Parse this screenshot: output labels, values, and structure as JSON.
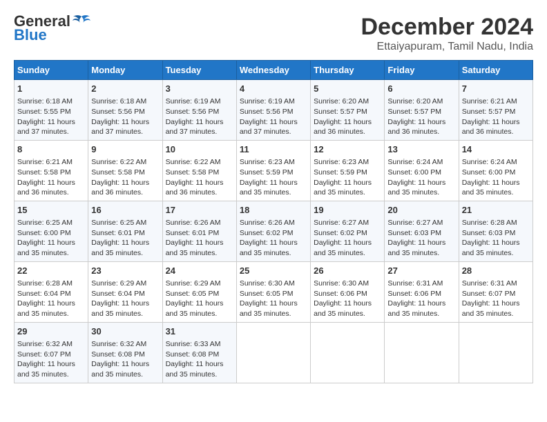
{
  "header": {
    "logo_line1": "General",
    "logo_line2": "Blue",
    "title": "December 2024",
    "subtitle": "Ettaiyapuram, Tamil Nadu, India"
  },
  "columns": [
    "Sunday",
    "Monday",
    "Tuesday",
    "Wednesday",
    "Thursday",
    "Friday",
    "Saturday"
  ],
  "weeks": [
    [
      {
        "day": "1",
        "lines": [
          "Sunrise: 6:18 AM",
          "Sunset: 5:55 PM",
          "Daylight: 11 hours",
          "and 37 minutes."
        ]
      },
      {
        "day": "2",
        "lines": [
          "Sunrise: 6:18 AM",
          "Sunset: 5:56 PM",
          "Daylight: 11 hours",
          "and 37 minutes."
        ]
      },
      {
        "day": "3",
        "lines": [
          "Sunrise: 6:19 AM",
          "Sunset: 5:56 PM",
          "Daylight: 11 hours",
          "and 37 minutes."
        ]
      },
      {
        "day": "4",
        "lines": [
          "Sunrise: 6:19 AM",
          "Sunset: 5:56 PM",
          "Daylight: 11 hours",
          "and 37 minutes."
        ]
      },
      {
        "day": "5",
        "lines": [
          "Sunrise: 6:20 AM",
          "Sunset: 5:57 PM",
          "Daylight: 11 hours",
          "and 36 minutes."
        ]
      },
      {
        "day": "6",
        "lines": [
          "Sunrise: 6:20 AM",
          "Sunset: 5:57 PM",
          "Daylight: 11 hours",
          "and 36 minutes."
        ]
      },
      {
        "day": "7",
        "lines": [
          "Sunrise: 6:21 AM",
          "Sunset: 5:57 PM",
          "Daylight: 11 hours",
          "and 36 minutes."
        ]
      }
    ],
    [
      {
        "day": "8",
        "lines": [
          "Sunrise: 6:21 AM",
          "Sunset: 5:58 PM",
          "Daylight: 11 hours",
          "and 36 minutes."
        ]
      },
      {
        "day": "9",
        "lines": [
          "Sunrise: 6:22 AM",
          "Sunset: 5:58 PM",
          "Daylight: 11 hours",
          "and 36 minutes."
        ]
      },
      {
        "day": "10",
        "lines": [
          "Sunrise: 6:22 AM",
          "Sunset: 5:58 PM",
          "Daylight: 11 hours",
          "and 36 minutes."
        ]
      },
      {
        "day": "11",
        "lines": [
          "Sunrise: 6:23 AM",
          "Sunset: 5:59 PM",
          "Daylight: 11 hours",
          "and 35 minutes."
        ]
      },
      {
        "day": "12",
        "lines": [
          "Sunrise: 6:23 AM",
          "Sunset: 5:59 PM",
          "Daylight: 11 hours",
          "and 35 minutes."
        ]
      },
      {
        "day": "13",
        "lines": [
          "Sunrise: 6:24 AM",
          "Sunset: 6:00 PM",
          "Daylight: 11 hours",
          "and 35 minutes."
        ]
      },
      {
        "day": "14",
        "lines": [
          "Sunrise: 6:24 AM",
          "Sunset: 6:00 PM",
          "Daylight: 11 hours",
          "and 35 minutes."
        ]
      }
    ],
    [
      {
        "day": "15",
        "lines": [
          "Sunrise: 6:25 AM",
          "Sunset: 6:00 PM",
          "Daylight: 11 hours",
          "and 35 minutes."
        ]
      },
      {
        "day": "16",
        "lines": [
          "Sunrise: 6:25 AM",
          "Sunset: 6:01 PM",
          "Daylight: 11 hours",
          "and 35 minutes."
        ]
      },
      {
        "day": "17",
        "lines": [
          "Sunrise: 6:26 AM",
          "Sunset: 6:01 PM",
          "Daylight: 11 hours",
          "and 35 minutes."
        ]
      },
      {
        "day": "18",
        "lines": [
          "Sunrise: 6:26 AM",
          "Sunset: 6:02 PM",
          "Daylight: 11 hours",
          "and 35 minutes."
        ]
      },
      {
        "day": "19",
        "lines": [
          "Sunrise: 6:27 AM",
          "Sunset: 6:02 PM",
          "Daylight: 11 hours",
          "and 35 minutes."
        ]
      },
      {
        "day": "20",
        "lines": [
          "Sunrise: 6:27 AM",
          "Sunset: 6:03 PM",
          "Daylight: 11 hours",
          "and 35 minutes."
        ]
      },
      {
        "day": "21",
        "lines": [
          "Sunrise: 6:28 AM",
          "Sunset: 6:03 PM",
          "Daylight: 11 hours",
          "and 35 minutes."
        ]
      }
    ],
    [
      {
        "day": "22",
        "lines": [
          "Sunrise: 6:28 AM",
          "Sunset: 6:04 PM",
          "Daylight: 11 hours",
          "and 35 minutes."
        ]
      },
      {
        "day": "23",
        "lines": [
          "Sunrise: 6:29 AM",
          "Sunset: 6:04 PM",
          "Daylight: 11 hours",
          "and 35 minutes."
        ]
      },
      {
        "day": "24",
        "lines": [
          "Sunrise: 6:29 AM",
          "Sunset: 6:05 PM",
          "Daylight: 11 hours",
          "and 35 minutes."
        ]
      },
      {
        "day": "25",
        "lines": [
          "Sunrise: 6:30 AM",
          "Sunset: 6:05 PM",
          "Daylight: 11 hours",
          "and 35 minutes."
        ]
      },
      {
        "day": "26",
        "lines": [
          "Sunrise: 6:30 AM",
          "Sunset: 6:06 PM",
          "Daylight: 11 hours",
          "and 35 minutes."
        ]
      },
      {
        "day": "27",
        "lines": [
          "Sunrise: 6:31 AM",
          "Sunset: 6:06 PM",
          "Daylight: 11 hours",
          "and 35 minutes."
        ]
      },
      {
        "day": "28",
        "lines": [
          "Sunrise: 6:31 AM",
          "Sunset: 6:07 PM",
          "Daylight: 11 hours",
          "and 35 minutes."
        ]
      }
    ],
    [
      {
        "day": "29",
        "lines": [
          "Sunrise: 6:32 AM",
          "Sunset: 6:07 PM",
          "Daylight: 11 hours",
          "and 35 minutes."
        ]
      },
      {
        "day": "30",
        "lines": [
          "Sunrise: 6:32 AM",
          "Sunset: 6:08 PM",
          "Daylight: 11 hours",
          "and 35 minutes."
        ]
      },
      {
        "day": "31",
        "lines": [
          "Sunrise: 6:33 AM",
          "Sunset: 6:08 PM",
          "Daylight: 11 hours",
          "and 35 minutes."
        ]
      },
      null,
      null,
      null,
      null
    ]
  ]
}
